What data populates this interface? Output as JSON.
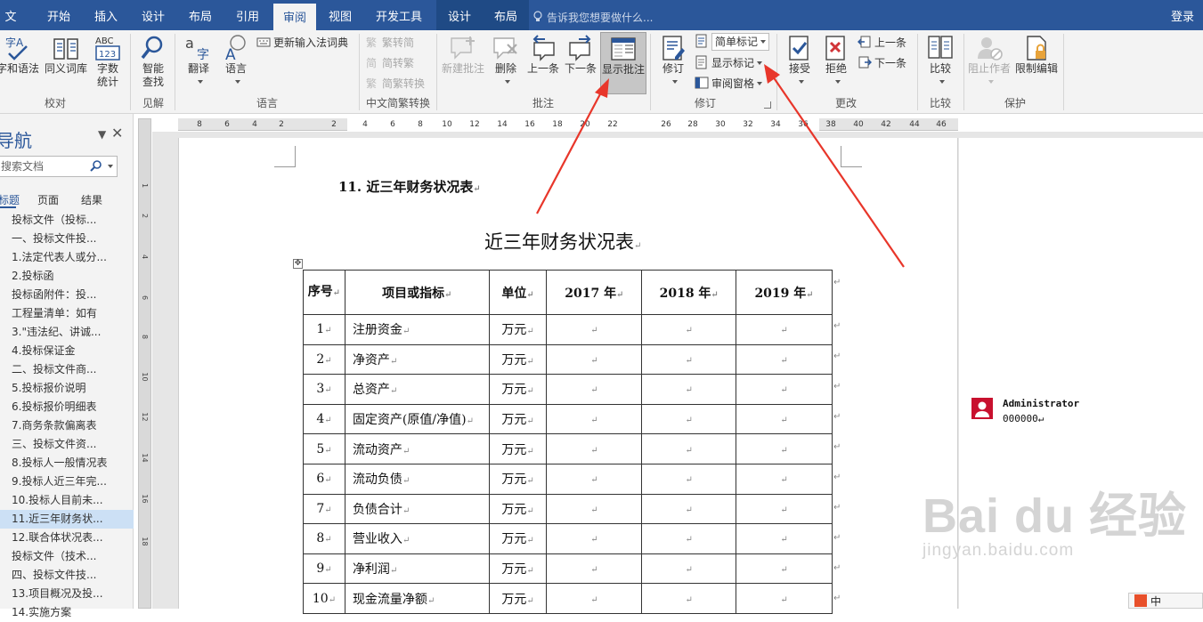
{
  "tabs": [
    {
      "label": "文件"
    },
    {
      "label": "开始"
    },
    {
      "label": "插入"
    },
    {
      "label": "设计"
    },
    {
      "label": "布局"
    },
    {
      "label": "引用"
    },
    {
      "label": "审阅"
    },
    {
      "label": "视图"
    },
    {
      "label": "开发工具"
    },
    {
      "label": "设计"
    },
    {
      "label": "布局"
    }
  ],
  "active_tab": "审阅",
  "tell_me": "告诉我您想要做什么...",
  "login": "登录",
  "ribbon": {
    "proofing": {
      "spelling": "字和语法",
      "thesaurus": "同义词库",
      "wordcount_1": "字数",
      "wordcount_2": "统计",
      "group": "校对",
      "abc": "ABC",
      "num": "123"
    },
    "insights": {
      "smart_1": "智能",
      "smart_2": "查找",
      "group": "见解"
    },
    "language": {
      "translate": "翻译",
      "language": "语言",
      "update_ime": "更新输入法词典",
      "group": "语言"
    },
    "chinese": {
      "t2s": "繁转简",
      "s2t": "简转繁",
      "convert": "简繁转换",
      "group": "中文简繁转换"
    },
    "comments": {
      "new": "新建批注",
      "delete": "删除",
      "prev": "上一条",
      "next": "下一条",
      "show": "显示批注",
      "group": "批注"
    },
    "tracking": {
      "track": "修订",
      "simple_markup": "简单标记",
      "show_markup": "显示标记",
      "reviewing_pane": "审阅窗格",
      "group": "修订"
    },
    "changes": {
      "accept": "接受",
      "reject": "拒绝",
      "prev": "上一条",
      "next": "下一条",
      "group": "更改"
    },
    "compare": {
      "compare": "比较",
      "group": "比较"
    },
    "protect": {
      "block": "阻止作者",
      "restrict": "限制编辑",
      "group": "保护"
    }
  },
  "nav": {
    "title": "导航",
    "search_placeholder": "搜索文档",
    "tabs": [
      "标题",
      "页面",
      "结果"
    ],
    "items": [
      "投标文件（投标...",
      "一、投标文件投...",
      "1.法定代表人或分...",
      "2.投标函",
      "投标函附件：投...",
      "工程量清单：如有",
      "3.\"违法纪、讲诚...",
      "4.投标保证金",
      "二、投标文件商...",
      "5.投标报价说明",
      "6.投标报价明细表",
      "7.商务条款偏离表",
      "三、投标文件资...",
      "8.投标人一般情况表",
      "9.投标人近三年完...",
      "10.投标人目前未...",
      "11.近三年财务状...",
      "12.联合体状况表...",
      "投标文件（技术...",
      "四、投标文件技...",
      "13.项目概况及投...",
      "14.实施方案"
    ],
    "selected_index": 16
  },
  "hruler": [
    "8",
    "6",
    "4",
    "2",
    "2",
    "4",
    "6",
    "8",
    "10",
    "12",
    "14",
    "16",
    "18",
    "20",
    "22",
    "26",
    "28",
    "30",
    "32",
    "34",
    "36",
    "38",
    "40",
    "42",
    "44",
    "46"
  ],
  "vruler": [
    "1",
    "2",
    "4",
    "6",
    "8",
    "10",
    "12",
    "14",
    "16",
    "18"
  ],
  "document": {
    "heading": "11. 近三年财务状况表",
    "table_title": "近三年财务状况表",
    "para_mark": "↵",
    "headers": [
      "序号",
      "项目或指标",
      "单位",
      "2017 年",
      "2018 年",
      "2019 年"
    ],
    "rows": [
      {
        "no": "1",
        "name": "注册资金",
        "unit": "万元"
      },
      {
        "no": "2",
        "name": "净资产",
        "unit": "万元"
      },
      {
        "no": "3",
        "name": "总资产",
        "unit": "万元"
      },
      {
        "no": "4",
        "name": "固定资产(原值/净值)",
        "unit": "万元"
      },
      {
        "no": "5",
        "name": "流动资产",
        "unit": "万元"
      },
      {
        "no": "6",
        "name": "流动负债",
        "unit": "万元"
      },
      {
        "no": "7",
        "name": "负债合计",
        "unit": "万元"
      },
      {
        "no": "8",
        "name": "营业收入",
        "unit": "万元"
      },
      {
        "no": "9",
        "name": "净利润",
        "unit": "万元"
      },
      {
        "no": "10",
        "name": "现金流量净额",
        "unit": "万元"
      }
    ]
  },
  "comment": {
    "author": "Administrator",
    "text": "000000↵"
  },
  "watermark": {
    "line1": "Bai du 经验",
    "line2": "jingyan.baidu.com"
  },
  "statusbar": {
    "ime": "中"
  },
  "colors": {
    "accent": "#2b579a",
    "annotation_arrow": "#e8362a",
    "comment_avatar": "#c8102e"
  }
}
